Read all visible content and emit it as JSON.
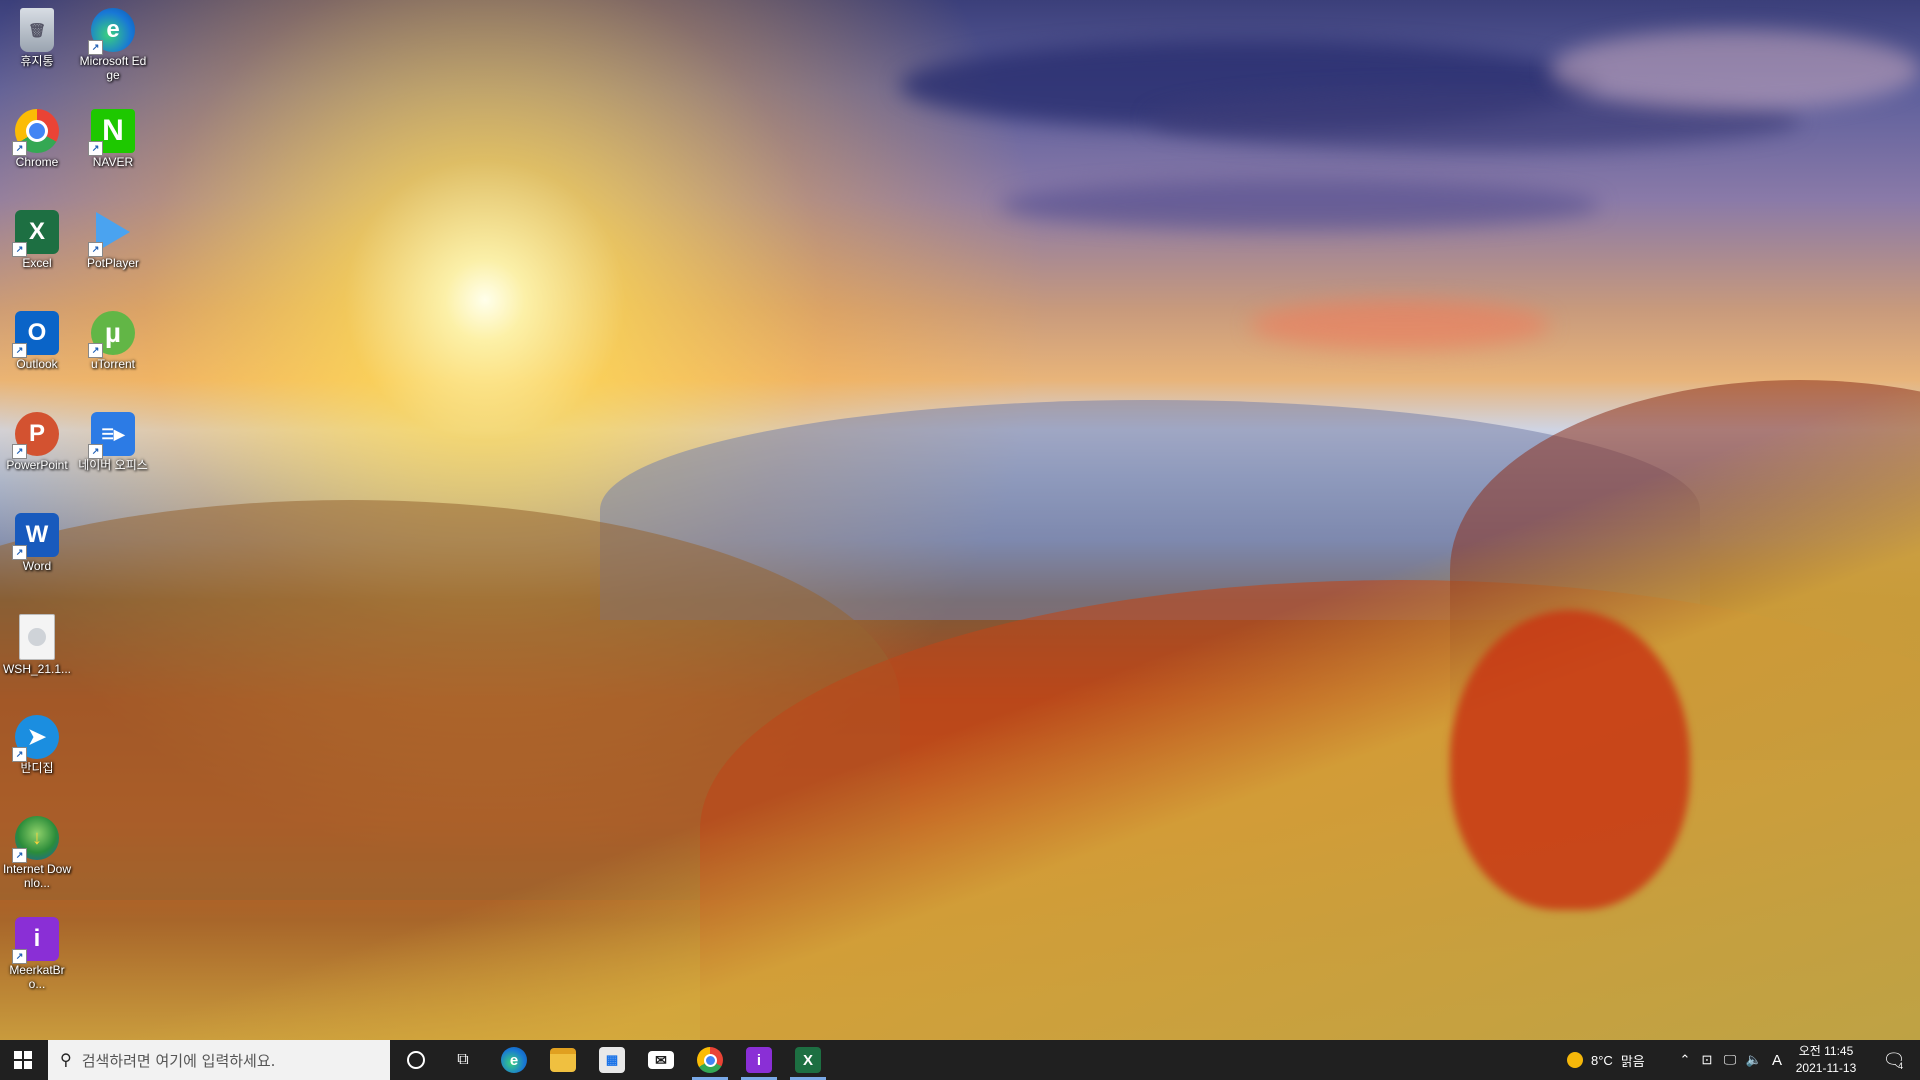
{
  "desktop_icons": [
    {
      "label": "휴지통",
      "icon": "recycle-bin-icon"
    },
    {
      "label": "Microsoft Edge",
      "icon": "edge-icon"
    },
    {
      "label": "Chrome",
      "icon": "chrome-icon"
    },
    {
      "label": "NAVER",
      "icon": "naver-icon"
    },
    {
      "label": "Excel",
      "icon": "excel-icon"
    },
    {
      "label": "PotPlayer",
      "icon": "potplayer-icon"
    },
    {
      "label": "Outlook",
      "icon": "outlook-icon"
    },
    {
      "label": "uTorrent",
      "icon": "utorrent-icon"
    },
    {
      "label": "PowerPoint",
      "icon": "powerpoint-icon"
    },
    {
      "label": "네이버 오피스",
      "icon": "naver-office-icon"
    },
    {
      "label": "Word",
      "icon": "word-icon"
    },
    {
      "label": "WSH_21.1...",
      "icon": "file-icon"
    },
    {
      "label": "반디집",
      "icon": "bandizip-icon"
    },
    {
      "label": "Internet Downlo...",
      "icon": "internet-download-manager-icon"
    },
    {
      "label": "MeerkatBro...",
      "icon": "meerkat-browser-icon"
    }
  ],
  "taskbar": {
    "search_placeholder": "검색하려면 여기에 입력하세요.",
    "pinned": [
      {
        "name": "edge",
        "icon": "edge-icon"
      },
      {
        "name": "file-explorer",
        "icon": "folder-icon"
      },
      {
        "name": "store",
        "icon": "store-icon"
      },
      {
        "name": "mail",
        "icon": "mail-icon"
      },
      {
        "name": "chrome",
        "icon": "chrome-icon"
      },
      {
        "name": "meerkat",
        "icon": "meerkat-browser-icon"
      },
      {
        "name": "excel",
        "icon": "excel-icon"
      }
    ],
    "weather": {
      "temp": "8°C",
      "condition": "맑음"
    },
    "input_indicator": "A",
    "clock": {
      "time": "오전 11:45",
      "date": "2021-11-13"
    },
    "notifications_count": "4"
  },
  "colors": {
    "taskbar_bg": "#202020",
    "accent_active": "#7aa9e6"
  }
}
